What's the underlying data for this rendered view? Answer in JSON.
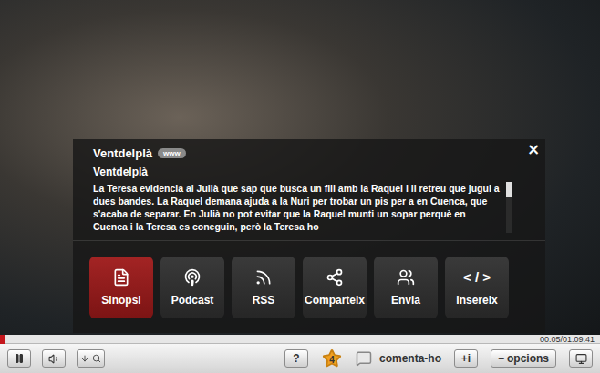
{
  "panel": {
    "title": "Ventdelplà",
    "badge": "www",
    "subtitle": "Ventdelplà",
    "synopsis": "La Teresa evidencia al Julià que sap que busca un fill amb la Raquel i li retreu que jugui a dues bandes. La Raquel demana ajuda a la Nuri per trobar un pis per a en Cuenca, que s'acaba de separar. En Julià no pot evitar que la Raquel munti un sopar perquè en Cuenca i la Teresa es coneguin, però la Teresa ho",
    "close": "×"
  },
  "actions": [
    {
      "label": "Sinopsi",
      "selected": true,
      "glyph": ""
    },
    {
      "label": "Podcast",
      "selected": false,
      "glyph": ""
    },
    {
      "label": "RSS",
      "selected": false,
      "glyph": ""
    },
    {
      "label": "Comparteix",
      "selected": false,
      "glyph": ""
    },
    {
      "label": "Envia",
      "selected": false,
      "glyph": ""
    },
    {
      "label": "Insereix",
      "selected": false,
      "glyph": "< / >"
    }
  ],
  "progress": {
    "level": 0.01,
    "time": "00:05/01:09:41"
  },
  "controls": {
    "help": "?",
    "rating": "4",
    "comment": "comenta-ho",
    "info": "+i",
    "options_sign": "−",
    "options": "opcions"
  }
}
